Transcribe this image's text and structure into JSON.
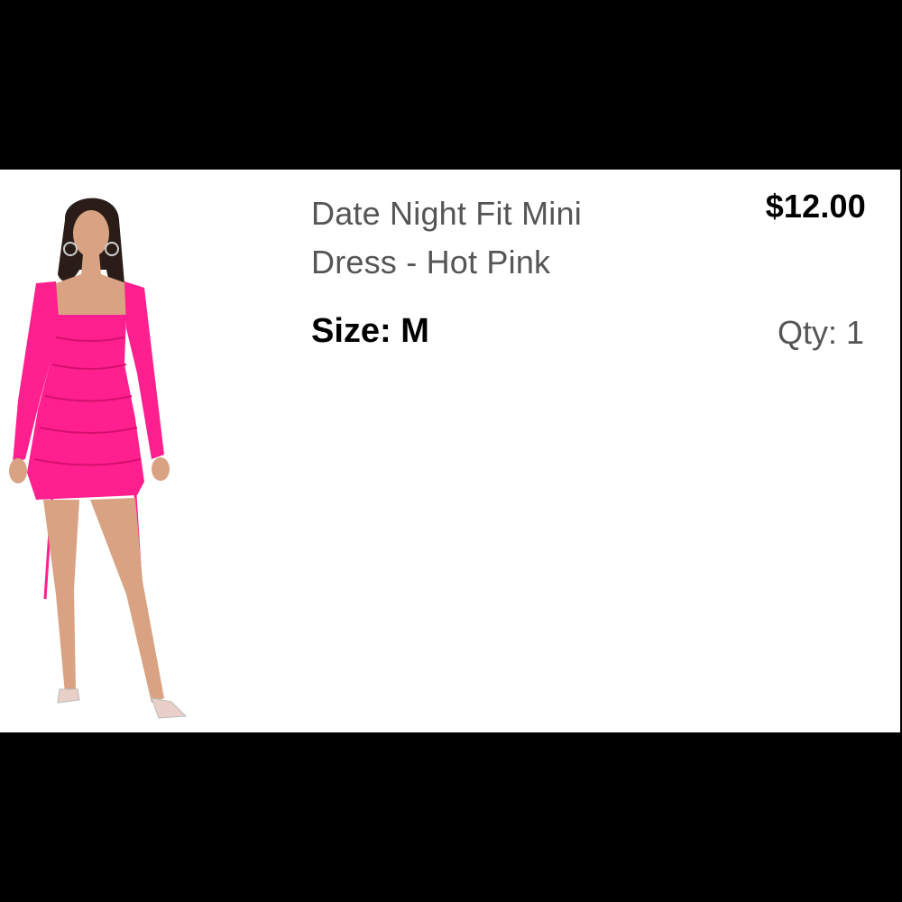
{
  "item": {
    "name": "Date Night Fit Mini Dress - Hot Pink",
    "price": "$12.00",
    "size_label": "Size: M",
    "quantity_label": "Qty: 1",
    "image_alt": "model wearing hot pink ruched mini dress",
    "dress_color": "#ff1f8e"
  }
}
